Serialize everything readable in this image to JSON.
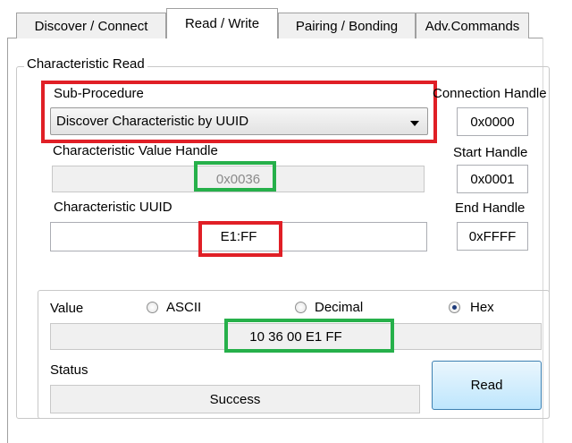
{
  "tabs": [
    {
      "label": "Discover / Connect"
    },
    {
      "label": "Read / Write"
    },
    {
      "label": "Pairing / Bonding"
    },
    {
      "label": "Adv.Commands"
    }
  ],
  "characteristic_read": {
    "title": "Characteristic Read",
    "sub_procedure": {
      "label": "Sub-Procedure",
      "value": "Discover Characteristic by UUID"
    },
    "value_handle": {
      "label": "Characteristic Value Handle",
      "value": "0x0036"
    },
    "uuid": {
      "label": "Characteristic UUID",
      "value": "E1:FF"
    },
    "connection_handle": {
      "label": "Connection Handle",
      "value": "0x0000"
    },
    "start_handle": {
      "label": "Start Handle",
      "value": "0x0001"
    },
    "end_handle": {
      "label": "End Handle",
      "value": "0xFFFF"
    },
    "value_box": {
      "label": "Value",
      "formats": [
        "ASCII",
        "Decimal",
        "Hex"
      ],
      "selected_format": "Hex",
      "value": "10 36 00 E1 FF"
    },
    "status": {
      "label": "Status",
      "value": "Success"
    },
    "read_button": "Read"
  },
  "highlight_colors": {
    "red": "#e01f26",
    "green": "#26b04a"
  }
}
